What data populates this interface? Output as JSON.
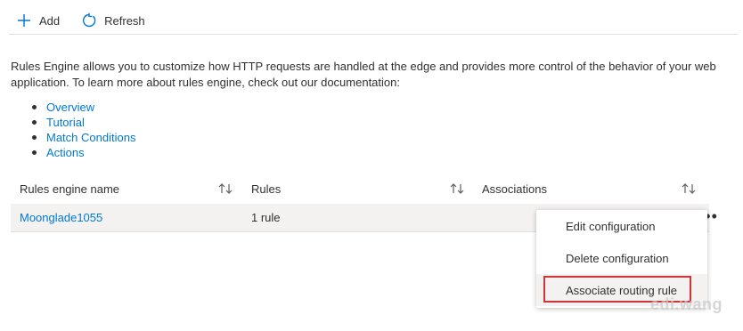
{
  "toolbar": {
    "add_label": "Add",
    "refresh_label": "Refresh"
  },
  "description": "Rules Engine allows you to customize how HTTP requests are handled at the edge and provides more control of the behavior of your web application. To learn more about rules engine, check out our documentation:",
  "links": [
    "Overview",
    "Tutorial",
    "Match Conditions",
    "Actions"
  ],
  "table": {
    "columns": [
      "Rules engine name",
      "Rules",
      "Associations"
    ],
    "rows": [
      {
        "name": "Moonglade1055",
        "rules": "1 rule",
        "associations": ""
      }
    ]
  },
  "row_menu": {
    "more_label": "•••",
    "items": [
      "Edit configuration",
      "Delete configuration",
      "Associate routing rule"
    ]
  },
  "watermark": "edi.wang",
  "colors": {
    "link": "#0078d4",
    "highlight_border": "#d13438",
    "row_bg": "#f3f2f1"
  }
}
